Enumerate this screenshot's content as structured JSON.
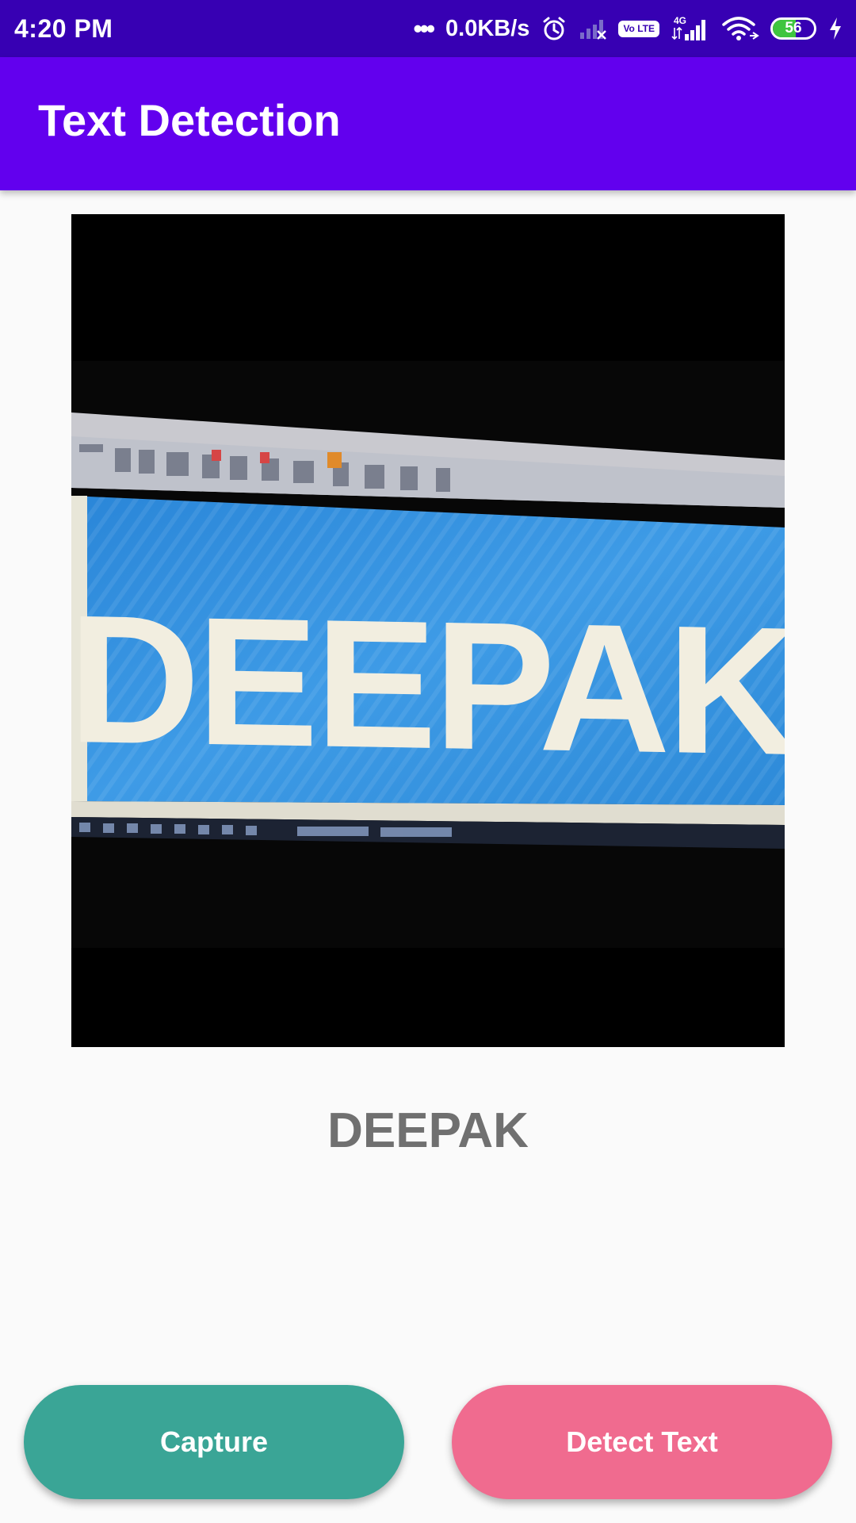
{
  "status_bar": {
    "time": "4:20 PM",
    "dots": "•••",
    "speed": "0.0KB/s",
    "volte": "Vo LTE",
    "network": "4G",
    "battery_level": "56",
    "battery_fraction": 0.56
  },
  "app_bar": {
    "title": "Text Detection"
  },
  "photo": {
    "detected_word_in_image": "DEEPAK"
  },
  "result": {
    "text": "DEEPAK"
  },
  "buttons": {
    "capture_label": "Capture",
    "detect_label": "Detect Text"
  },
  "colors": {
    "status_bar": "#3700b3",
    "app_bar": "#6200ee",
    "capture": "#3aa596",
    "detect": "#f06b8f",
    "result_text": "#707070"
  }
}
